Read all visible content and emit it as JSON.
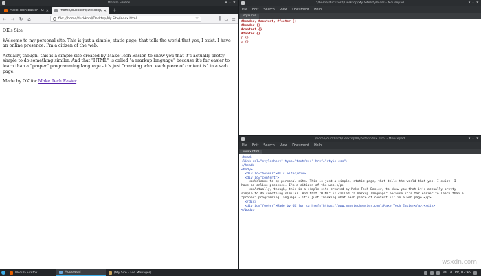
{
  "firefox": {
    "window_title": "Mozilla Firefox",
    "tabs": [
      {
        "label": "Make Tech Easier - Comp"
      },
      {
        "label": "/home/duckkord/Desktop/My"
      }
    ],
    "new_tab": "+",
    "url": "file:///home/duckkord/Desktop/My Site/index.html",
    "page": {
      "site_title": "OK's Site",
      "p1": "Welcome to my personal site. This is just a simple, static page, that tells the world that yes, I exist. I have an online presence. I'm a citizen of the web.",
      "p2": "Actually, though, this is a simple site created by Make Tech Easier, to show you that it's actually pretty simple to do something similar. And that \"HTML\" is called \"a markup language\" because it's far easier to learn than a \"proper\" programming language - it's just \"marking what each piece of content is\" in a web page.",
      "footer_prefix": "Made by OK for ",
      "footer_link": "Make Tech Easier",
      "footer_suffix": "."
    }
  },
  "mousepad_css": {
    "window_title": "*/home/duckkord/Desktop/My Site/style.css - Mousepad",
    "menu": [
      "File",
      "Edit",
      "Search",
      "View",
      "Document",
      "Help"
    ],
    "tab": "style.css",
    "lines": [
      "#header, #content, #footer {}",
      "#header {}",
      "#content {}",
      "#footer {}",
      "p {}",
      "a {}"
    ]
  },
  "mousepad_html": {
    "window_title": "/home/duckkord/Desktop/My Site/index.html - Mousepad",
    "menu": [
      "File",
      "Edit",
      "Search",
      "View",
      "Document",
      "Help"
    ],
    "tab": "index.html",
    "lines": [
      "<head>",
      "<link rel=\"stylesheet\" type=\"text/css\" href=\"style.css\">",
      "</head>",
      "",
      "<body>",
      "  <div id=\"header\">OK's Site</div>",
      "  <div id=\"content\">",
      "    <p>Welcome to my personal site. This is just a simple, static page, that tells the world that yes, I exist. I",
      "have an online presence. I'm a citizen of the web.</p>",
      "    <p>Actually, though, this is a simple site created by Make Tech Easier, to show you that it's actually pretty",
      "simple to do something similar. And that \"HTML\" is called \"a markup language\" because it's far easier to learn than a",
      "\"proper\" programming language - it's just \"marking what each piece of content is\" in a web page.</p>",
      "  </div>",
      "  <div id=\"footer\">Made by OK for <a href=\"https://www.maketecheasier.com\">Make Tech Easier</a>.</div>",
      "</body>"
    ]
  },
  "taskbar": {
    "items": [
      {
        "label": "Mozilla Firefox"
      },
      {
        "label": "Mousepad"
      },
      {
        "label": "[My Site - File Manager]"
      }
    ],
    "clock": "Pel 1o Unt, 02:45"
  },
  "watermark": "wsxdn.com",
  "colors": {
    "desktop": "#1b1e21",
    "titlebar": "#2b2e31",
    "accent": "#3daee9",
    "link": "#5522aa"
  }
}
